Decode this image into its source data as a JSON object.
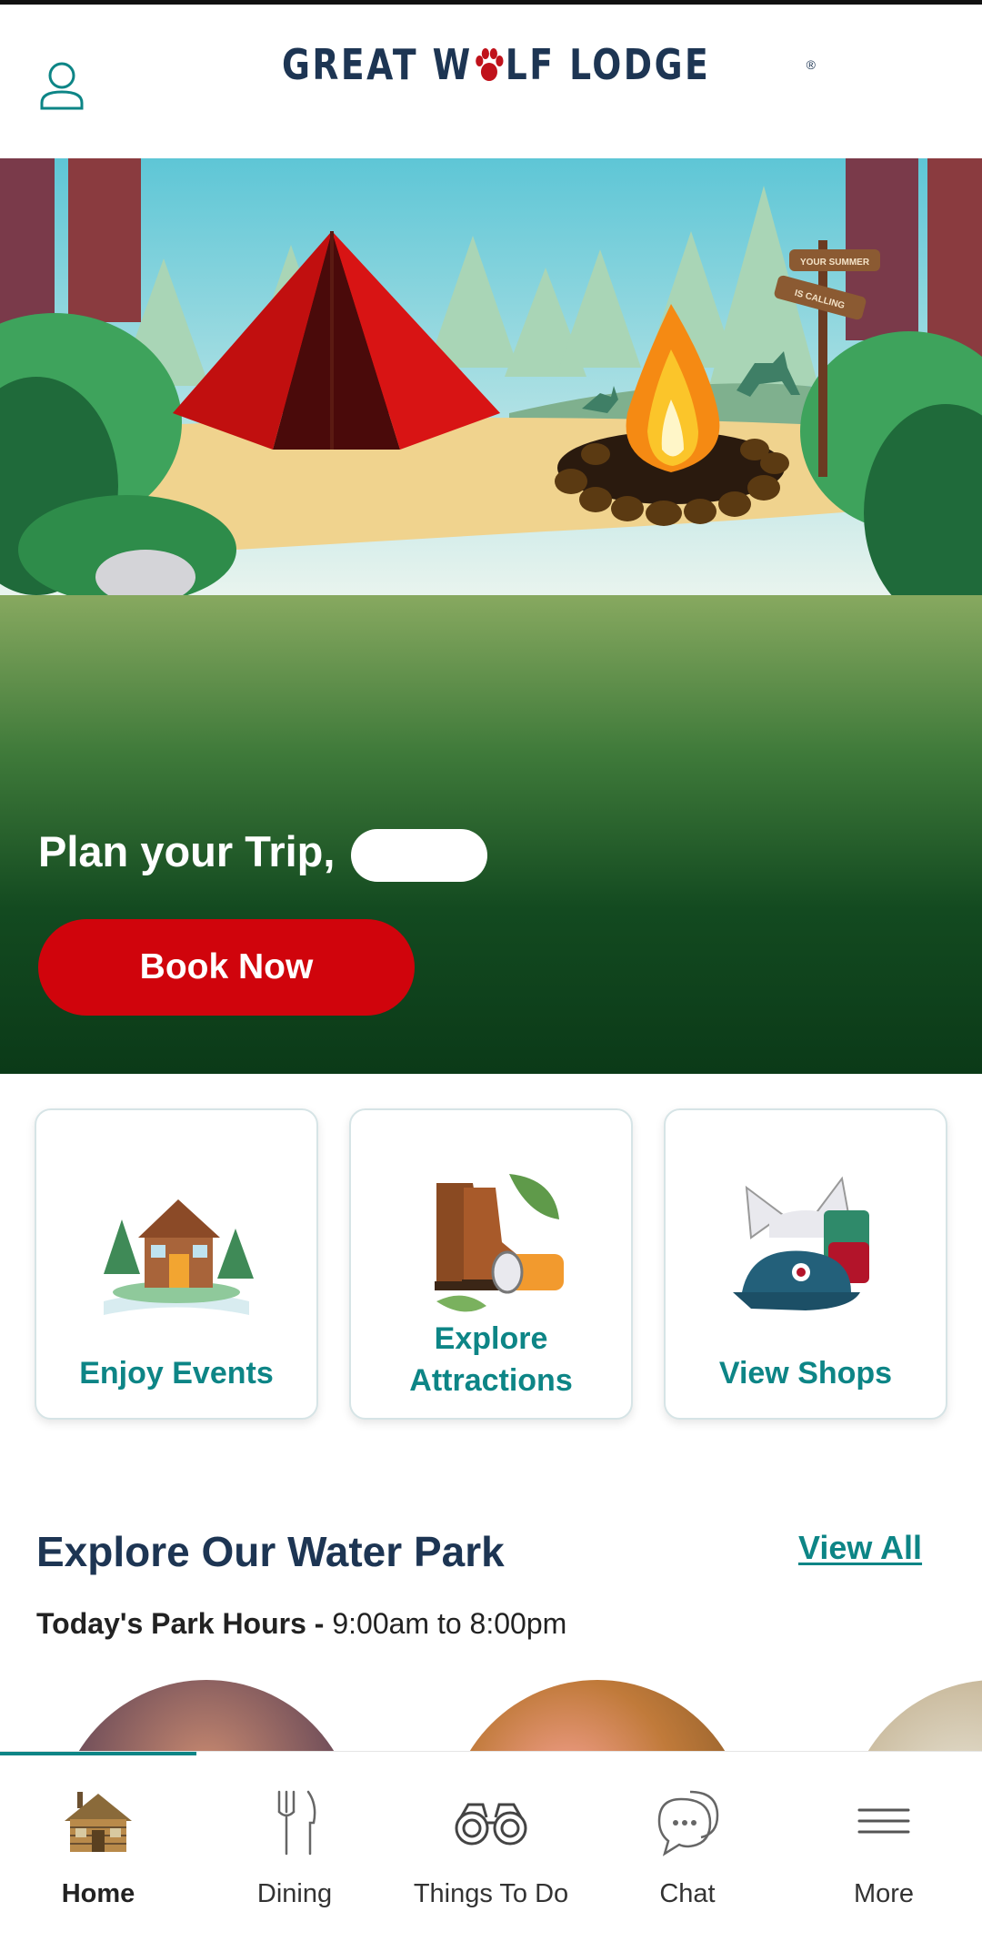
{
  "header": {
    "logo_text_before": "GREAT W",
    "logo_paw": "✿",
    "logo_text_after": "LF LODGE",
    "logo_reg": "®",
    "account_icon": "user-outline-icon"
  },
  "hero": {
    "greeting": "Plan your Trip, ",
    "sign_line1": "YOUR SUMMER",
    "sign_line2": "IS CALLING",
    "book_button": "Book Now"
  },
  "quick_links": [
    {
      "label": "Enjoy Events",
      "icon": "cabin-book-icon"
    },
    {
      "label_line1": "Explore",
      "label_line2": "Attractions",
      "icon": "hiking-boots-icon"
    },
    {
      "label": "View Shops",
      "icon": "wolf-ears-cap-mug-icon"
    }
  ],
  "water_park": {
    "title": "Explore Our Water Park",
    "view_all": "View All",
    "hours_label": "Today's Park Hours - ",
    "hours_value": "9:00am to 8:00pm"
  },
  "tabs": [
    {
      "label": "Home",
      "icon": "cabin-icon",
      "active": true
    },
    {
      "label": "Dining",
      "icon": "fork-knife-icon",
      "active": false
    },
    {
      "label": "Things To Do",
      "icon": "binoculars-icon",
      "active": false
    },
    {
      "label": "Chat",
      "icon": "chat-bubbles-icon",
      "active": false
    },
    {
      "label": "More",
      "icon": "hamburger-menu-icon",
      "active": false
    }
  ],
  "colors": {
    "brand_navy": "#1d3553",
    "brand_teal": "#0d8586",
    "brand_red": "#d0040c"
  }
}
